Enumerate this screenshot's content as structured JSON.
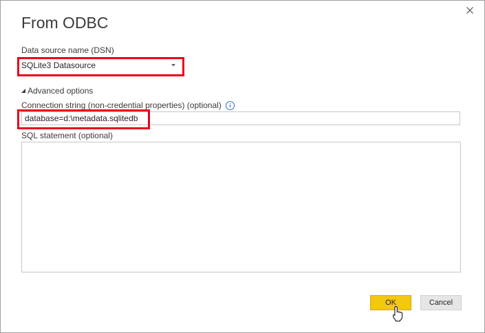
{
  "dialog": {
    "title": "From ODBC",
    "close_label": "×"
  },
  "dsn": {
    "label": "Data source name (DSN)",
    "selected": "SQLite3 Datasource"
  },
  "advanced": {
    "label": "Advanced options",
    "expanded": true
  },
  "connection_string": {
    "label": "Connection string (non-credential properties) (optional)",
    "value": "database=d:\\metadata.sqlitedb"
  },
  "sql_statement": {
    "label": "SQL statement (optional)",
    "value": ""
  },
  "buttons": {
    "ok": "OK",
    "cancel": "Cancel"
  },
  "colors": {
    "accent_ok": "#f2c811",
    "highlight_outline": "#e8001c",
    "info_icon": "#2e6fbf"
  },
  "icons": [
    "close-icon",
    "chevron-down-icon",
    "triangle-expanded-icon",
    "info-icon",
    "mouse-cursor-icon"
  ]
}
